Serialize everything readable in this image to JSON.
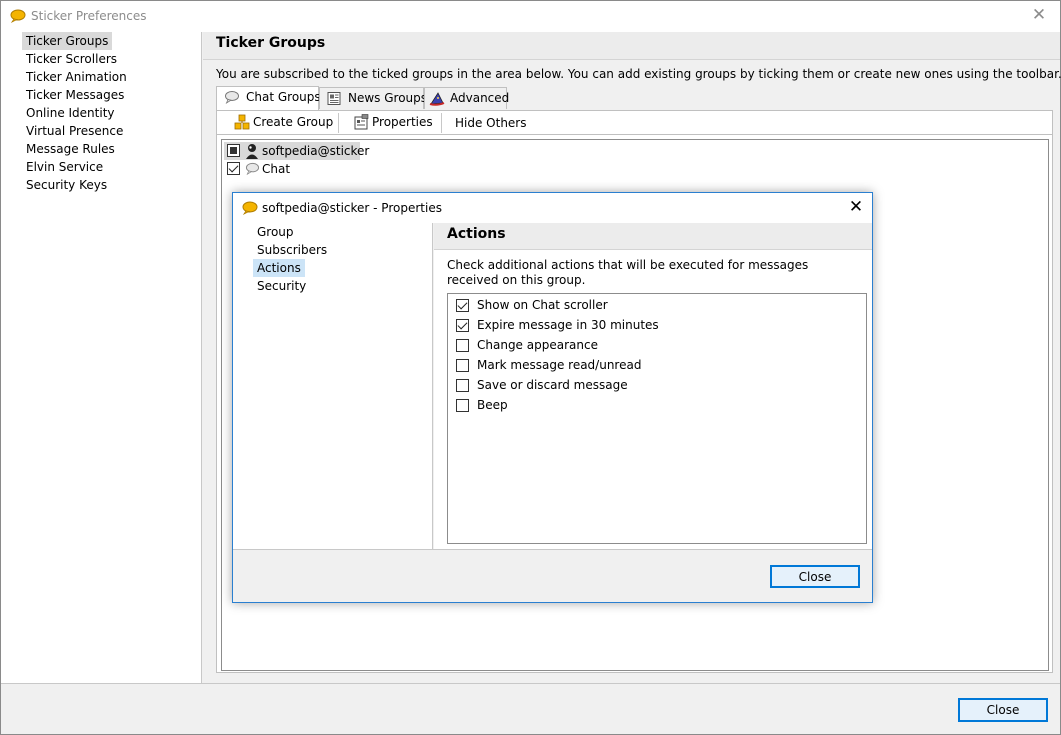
{
  "window": {
    "title": "Sticker Preferences",
    "close_glyph": "✕"
  },
  "sidebar": {
    "items": [
      {
        "label": "Ticker Groups"
      },
      {
        "label": "Ticker Scrollers"
      },
      {
        "label": "Ticker Animation"
      },
      {
        "label": "Ticker Messages"
      },
      {
        "label": "Online Identity"
      },
      {
        "label": "Virtual Presence"
      },
      {
        "label": "Message Rules"
      },
      {
        "label": "Elvin Service"
      },
      {
        "label": "Security Keys"
      }
    ],
    "selected": "Ticker Groups"
  },
  "main": {
    "title": "Ticker Groups",
    "description": "You are subscribed to the ticked groups in the area below. You can add existing groups by ticking them or create new ones using the toolbar.",
    "tabs": [
      {
        "label": "Chat Groups",
        "icon": "speech-bubble-icon"
      },
      {
        "label": "News Groups",
        "icon": "newspaper-icon"
      },
      {
        "label": "Advanced",
        "icon": "wizard-hat-icon"
      }
    ],
    "active_tab": "Chat Groups",
    "toolbar": {
      "create_group": "Create Group",
      "properties": "Properties",
      "hide_others": "Hide Others"
    },
    "tree": [
      {
        "label": "softpedia@sticker",
        "state": "partial",
        "icon": "user-silhouette-icon"
      },
      {
        "label": "Chat",
        "state": "checked",
        "icon": "speech-bubble-icon"
      }
    ]
  },
  "footer": {
    "close_label": "Close"
  },
  "dialog": {
    "title": "softpedia@sticker - Properties",
    "close_glyph": "✕",
    "side_items": [
      {
        "label": "Group"
      },
      {
        "label": "Subscribers"
      },
      {
        "label": "Actions"
      },
      {
        "label": "Security"
      }
    ],
    "selected": "Actions",
    "heading": "Actions",
    "description": "Check additional actions that will be executed for messages received on this group.",
    "actions": [
      {
        "label": "Show on Chat scroller",
        "checked": true
      },
      {
        "label": "Expire message in 30 minutes",
        "checked": true
      },
      {
        "label": "Change appearance",
        "checked": false
      },
      {
        "label": "Mark message read/unread",
        "checked": false
      },
      {
        "label": "Save or discard message",
        "checked": false
      },
      {
        "label": "Beep",
        "checked": false
      }
    ],
    "close_label": "Close"
  },
  "colors": {
    "accent": "#0078d7",
    "selection": "#cce4f7",
    "sidebar_selection": "#d9d9d9",
    "icon_yellow": "#f4b400"
  }
}
